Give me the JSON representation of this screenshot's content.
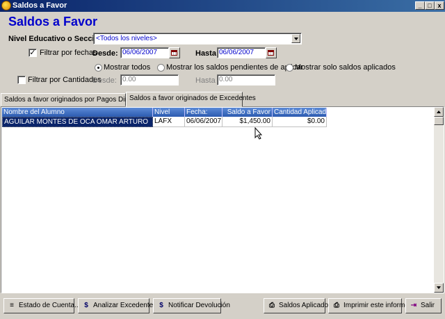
{
  "window": {
    "title": "Saldos a Favor",
    "buttons": [
      "_",
      "□",
      "x"
    ]
  },
  "heading": "Saldos a Favor",
  "filters": {
    "nivel_label": "Nivel Educativo o Sección",
    "nivel_value": "<Todos los niveles>",
    "fechas_label": "Filtrar por fechas",
    "fechas_checked": true,
    "desde_label": "Desde:",
    "desde_value": "06/06/2007",
    "hasta_label": "Hasta",
    "hasta_value": "06/06/2007",
    "radios": [
      {
        "label": "Mostrar todos",
        "selected": true
      },
      {
        "label": "Mostrar los saldos pendientes de aplicar",
        "selected": false
      },
      {
        "label": "Mostrar solo saldos aplicados",
        "selected": false
      }
    ],
    "cantidades_label": "Filtrar por Cantidades",
    "cantidades_checked": false,
    "cant_desde_label": "Desde:",
    "cant_desde_value": "0.00",
    "cant_hasta_label": "Hasta",
    "cant_hasta_value": "0.00"
  },
  "tabs": [
    {
      "label": "Saldos a favor originados por Pagos Directos",
      "active": false
    },
    {
      "label": "Saldos a favor originados de Excedentes",
      "active": true
    }
  ],
  "grid": {
    "columns": [
      "Nombre del Alumno",
      "Nivel",
      "Fecha:",
      "Saldo a Favor",
      "Cantidad Aplicada"
    ],
    "rows": [
      [
        "AGUILAR MONTES DE OCA OMAR ARTURO",
        "LAFX",
        "06/06/2007",
        "$1,450.00",
        "$0.00"
      ]
    ]
  },
  "buttons": {
    "estado": "Estado de Cuenta...",
    "analizar": "Analizar Excedentes",
    "notificar": "Notificar Devolución",
    "saldos_aplicados": "Saldos Aplicados",
    "imprimir": "Imprimir este informe",
    "salir": "Salir"
  },
  "icons": {
    "estado": "ledger-icon",
    "analizar": "dollar-icon",
    "notificar": "dollar-icon",
    "saldos_aplicados": "printer-icon",
    "imprimir": "printer-icon",
    "salir": "exit-icon"
  }
}
